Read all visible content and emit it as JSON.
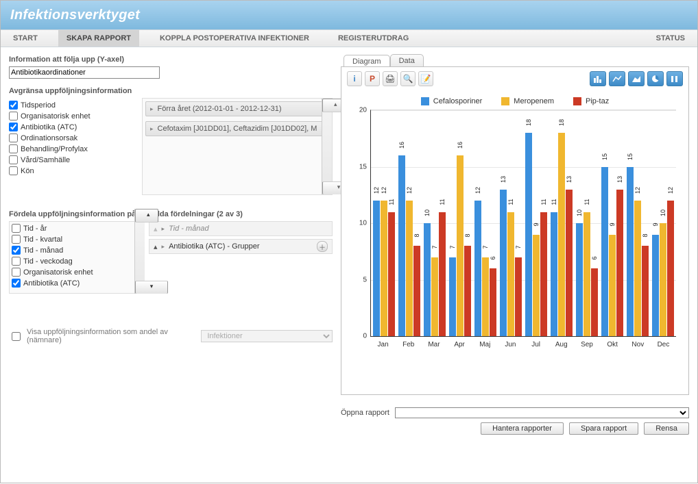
{
  "app_title": "Infektionsverktyget",
  "menu": {
    "start": "START",
    "create_report": "SKAPA RAPPORT",
    "koppla": "KOPPLA POSTOPERATIVA INFEKTIONER",
    "registerutdrag": "REGISTERUTDRAG",
    "status": "STATUS"
  },
  "left": {
    "yaxis_label": "Information att följa upp (Y-axel)",
    "yaxis_value": "Antibiotikaordinationer",
    "filter_title": "Avgränsa uppföljningsinformation",
    "filters": {
      "tidsperiod": "Tidsperiod",
      "org": "Organisatorisk enhet",
      "atc": "Antibiotika (ATC)",
      "orsak": "Ordinationsorsak",
      "beh": "Behandling/Profylax",
      "vard": "Vård/Samhälle",
      "kon": "Kön"
    },
    "filter_values": {
      "tidsperiod": "Förra året (2012-01-01 - 2012-12-31)",
      "atc": "Cefotaxim [J01DD01], Ceftazidim [J01DD02], M"
    },
    "distribute_title": "Fördela uppföljningsinformation på",
    "distribute_options": {
      "year": "Tid - år",
      "quarter": "Tid - kvartal",
      "month": "Tid - månad",
      "weekday": "Tid - veckodag",
      "org": "Organisatorisk enhet",
      "atc": "Antibiotika (ATC)"
    },
    "selected_title": "Valda fördelningar (2 av 3)",
    "selected": {
      "month": "Tid - månad",
      "atc_groups": "Antibiotika (ATC) - Grupper"
    },
    "andel_label": "Visa uppföljningsinformation som andel av (nämnare)",
    "andel_value": "Infektioner"
  },
  "right": {
    "tab_diagram": "Diagram",
    "tab_data": "Data",
    "open_report_label": "Öppna rapport",
    "btn_manage": "Hantera rapporter",
    "btn_save": "Spara rapport",
    "btn_clear": "Rensa"
  },
  "chart_data": {
    "type": "bar",
    "categories": [
      "Jan",
      "Feb",
      "Mar",
      "Apr",
      "Maj",
      "Jun",
      "Jul",
      "Aug",
      "Sep",
      "Okt",
      "Nov",
      "Dec"
    ],
    "series": [
      {
        "name": "Cefalosporiner",
        "color": "#3a8fdd",
        "values": [
          12,
          16,
          10,
          7,
          12,
          13,
          18,
          11,
          10,
          15,
          15,
          9
        ]
      },
      {
        "name": "Meropenem",
        "color": "#f0b72f",
        "values": [
          12,
          12,
          7,
          16,
          7,
          11,
          9,
          18,
          11,
          9,
          12,
          10
        ]
      },
      {
        "name": "Pip-taz",
        "color": "#cc3a25",
        "values": [
          11,
          8,
          11,
          8,
          6,
          7,
          11,
          13,
          6,
          13,
          8,
          12
        ]
      }
    ],
    "ylim": [
      0,
      20
    ],
    "yticks": [
      0,
      5,
      10,
      15,
      20
    ],
    "title": "",
    "xlabel": "",
    "ylabel": ""
  }
}
